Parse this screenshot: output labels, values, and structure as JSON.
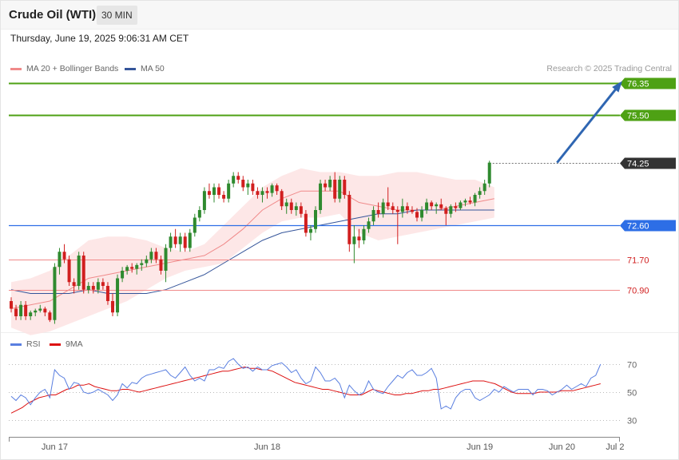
{
  "header": {
    "title": "Crude Oil (WTI)",
    "interval": "30 MIN"
  },
  "timestamp": "Thursday, June 19, 2025 9:06:31 AM CET",
  "legend": {
    "ma20_label": "MA 20 + Bollinger Bands",
    "ma50_label": "MA 50",
    "credit": "Research © 2025 Trading Central"
  },
  "rsi_legend": {
    "rsi_label": "RSI",
    "ma_label": "9MA"
  },
  "colors": {
    "resistance": "#4ea114",
    "support_blue": "#2d6ee6",
    "support_red": "#f08a8a",
    "current": "#333333",
    "up": "#2f8a2f",
    "down": "#d11f1f",
    "bollinger_fill": "#fde3e3",
    "ma20": "#f08a8a",
    "ma50": "#35559a",
    "arrow": "#2f66b2",
    "rsi": "#5a7fe0",
    "rsi_ma": "#dd1111"
  },
  "chart_data": {
    "type": "candlestick",
    "price_axis": {
      "min": 69.8,
      "max": 76.6
    },
    "levels": [
      {
        "value": 76.35,
        "label": "76.35",
        "kind": "resistance"
      },
      {
        "value": 75.5,
        "label": "75.50",
        "kind": "resistance"
      },
      {
        "value": 74.25,
        "label": "74.25",
        "kind": "current"
      },
      {
        "value": 72.6,
        "label": "72.60",
        "kind": "pivot"
      },
      {
        "value": 71.7,
        "label": "71.70",
        "kind": "support"
      },
      {
        "value": 70.9,
        "label": "70.90",
        "kind": "support"
      }
    ],
    "x_ticks": [
      "Jun 17",
      "Jun 18",
      "Jun 19",
      "Jun 20",
      "Jul 2"
    ],
    "x_tick_index": [
      9,
      53,
      97,
      114,
      125
    ],
    "x_count": 127,
    "projection": {
      "from_index": 113,
      "from_value": 74.25,
      "to_index": 127,
      "to_value": 76.35
    },
    "candles": [
      [
        70.6,
        70.7,
        70.3,
        70.4
      ],
      [
        70.4,
        70.5,
        70.1,
        70.2
      ],
      [
        70.2,
        70.6,
        70.1,
        70.5
      ],
      [
        70.5,
        70.6,
        70.1,
        70.2
      ],
      [
        70.2,
        70.35,
        70.1,
        70.3
      ],
      [
        70.3,
        70.4,
        70.2,
        70.35
      ],
      [
        70.35,
        70.5,
        70.3,
        70.4
      ],
      [
        70.4,
        70.45,
        70.2,
        70.3
      ],
      [
        70.3,
        70.35,
        70.05,
        70.1
      ],
      [
        70.1,
        71.6,
        70.0,
        71.5
      ],
      [
        71.5,
        72.0,
        71.3,
        71.9
      ],
      [
        71.9,
        72.1,
        71.6,
        71.7
      ],
      [
        71.7,
        71.8,
        71.0,
        71.1
      ],
      [
        71.1,
        71.2,
        70.8,
        71.0
      ],
      [
        71.0,
        71.9,
        70.9,
        71.8
      ],
      [
        71.8,
        71.9,
        70.8,
        70.9
      ],
      [
        70.9,
        71.1,
        70.8,
        71.0
      ],
      [
        71.0,
        71.1,
        70.8,
        70.9
      ],
      [
        70.9,
        71.2,
        70.8,
        71.1
      ],
      [
        71.1,
        71.2,
        70.9,
        71.0
      ],
      [
        71.0,
        71.1,
        70.5,
        70.6
      ],
      [
        70.6,
        70.8,
        70.2,
        70.3
      ],
      [
        70.3,
        71.3,
        70.2,
        71.2
      ],
      [
        71.2,
        71.5,
        71.1,
        71.4
      ],
      [
        71.4,
        71.55,
        71.3,
        71.5
      ],
      [
        71.5,
        71.6,
        71.35,
        71.45
      ],
      [
        71.45,
        71.6,
        71.3,
        71.55
      ],
      [
        71.55,
        71.7,
        71.4,
        71.6
      ],
      [
        71.6,
        71.8,
        71.5,
        71.7
      ],
      [
        71.7,
        72.0,
        71.6,
        71.9
      ],
      [
        71.9,
        72.0,
        71.6,
        71.7
      ],
      [
        71.7,
        71.8,
        71.3,
        71.4
      ],
      [
        71.4,
        72.1,
        71.1,
        72.0
      ],
      [
        72.0,
        72.4,
        71.9,
        72.3
      ],
      [
        72.3,
        72.5,
        72.0,
        72.1
      ],
      [
        72.1,
        72.4,
        71.9,
        72.3
      ],
      [
        72.3,
        72.4,
        71.9,
        72.0
      ],
      [
        72.0,
        72.5,
        71.9,
        72.4
      ],
      [
        72.4,
        72.9,
        72.3,
        72.8
      ],
      [
        72.8,
        73.1,
        72.7,
        73.0
      ],
      [
        73.0,
        73.6,
        72.9,
        73.5
      ],
      [
        73.5,
        73.7,
        73.3,
        73.4
      ],
      [
        73.4,
        73.7,
        73.2,
        73.6
      ],
      [
        73.6,
        73.7,
        73.3,
        73.4
      ],
      [
        73.4,
        73.5,
        73.2,
        73.3
      ],
      [
        73.3,
        73.8,
        73.2,
        73.7
      ],
      [
        73.7,
        74.0,
        73.6,
        73.9
      ],
      [
        73.9,
        74.0,
        73.7,
        73.8
      ],
      [
        73.8,
        73.9,
        73.5,
        73.6
      ],
      [
        73.6,
        73.8,
        73.4,
        73.7
      ],
      [
        73.7,
        73.8,
        73.4,
        73.5
      ],
      [
        73.5,
        73.6,
        73.3,
        73.4
      ],
      [
        73.4,
        73.6,
        73.2,
        73.5
      ],
      [
        73.5,
        73.6,
        73.3,
        73.45
      ],
      [
        73.45,
        73.7,
        73.35,
        73.65
      ],
      [
        73.65,
        73.7,
        73.4,
        73.5
      ],
      [
        73.5,
        73.55,
        73.0,
        73.1
      ],
      [
        73.1,
        73.3,
        72.9,
        73.2
      ],
      [
        73.2,
        73.3,
        72.9,
        73.0
      ],
      [
        73.0,
        73.2,
        72.85,
        73.1
      ],
      [
        73.1,
        73.2,
        72.8,
        72.9
      ],
      [
        72.9,
        73.0,
        72.3,
        72.4
      ],
      [
        72.4,
        72.6,
        72.2,
        72.5
      ],
      [
        72.5,
        73.1,
        72.4,
        73.0
      ],
      [
        73.0,
        73.8,
        72.9,
        73.7
      ],
      [
        73.7,
        73.8,
        73.5,
        73.6
      ],
      [
        73.6,
        73.9,
        73.5,
        73.8
      ],
      [
        73.8,
        74.0,
        73.2,
        73.3
      ],
      [
        73.3,
        73.9,
        73.2,
        73.8
      ],
      [
        73.8,
        73.9,
        73.3,
        73.4
      ],
      [
        73.4,
        73.5,
        71.9,
        72.1
      ],
      [
        72.1,
        72.6,
        71.6,
        72.3
      ],
      [
        72.3,
        72.5,
        72.0,
        72.2
      ],
      [
        72.2,
        72.6,
        72.1,
        72.5
      ],
      [
        72.5,
        72.8,
        72.4,
        72.7
      ],
      [
        72.7,
        73.1,
        72.6,
        73.0
      ],
      [
        73.0,
        73.2,
        72.8,
        72.9
      ],
      [
        72.9,
        73.3,
        72.8,
        73.2
      ],
      [
        73.2,
        73.6,
        73.0,
        73.1
      ],
      [
        73.1,
        73.2,
        72.9,
        73.0
      ],
      [
        73.0,
        73.1,
        72.1,
        72.95
      ],
      [
        72.95,
        73.3,
        72.8,
        73.1
      ],
      [
        73.1,
        73.2,
        72.9,
        73.0
      ],
      [
        73.0,
        73.1,
        72.9,
        72.95
      ],
      [
        72.95,
        73.05,
        72.7,
        72.8
      ],
      [
        72.8,
        73.1,
        72.7,
        73.0
      ],
      [
        73.0,
        73.3,
        72.9,
        73.2
      ],
      [
        73.2,
        73.25,
        73.0,
        73.1
      ],
      [
        73.1,
        73.2,
        72.9,
        73.15
      ],
      [
        73.15,
        73.3,
        73.0,
        73.05
      ],
      [
        73.05,
        73.1,
        72.6,
        72.9
      ],
      [
        72.9,
        73.15,
        72.8,
        73.1
      ],
      [
        73.1,
        73.2,
        72.95,
        73.05
      ],
      [
        73.05,
        73.25,
        73.0,
        73.2
      ],
      [
        73.2,
        73.3,
        73.1,
        73.25
      ],
      [
        73.25,
        73.35,
        73.15,
        73.2
      ],
      [
        73.2,
        73.45,
        73.1,
        73.4
      ],
      [
        73.4,
        73.6,
        73.3,
        73.5
      ],
      [
        73.5,
        73.8,
        73.4,
        73.7
      ],
      [
        73.7,
        74.3,
        73.6,
        74.25
      ]
    ],
    "bollinger": {
      "upper": [
        71.1,
        71.2,
        71.4,
        71.8,
        72.2,
        72.3,
        72.3,
        72.2,
        72.0,
        71.9,
        72.1,
        72.6,
        73.1,
        73.6,
        73.9,
        74.1,
        74.0,
        74.0,
        73.9,
        73.9,
        74.0,
        74.0,
        73.9,
        73.8,
        73.8,
        73.6
      ],
      "lower": [
        69.9,
        69.7,
        69.8,
        70.0,
        70.2,
        70.4,
        70.6,
        70.9,
        71.2,
        71.4,
        71.5,
        71.6,
        72.0,
        72.4,
        72.7,
        72.8,
        72.8,
        72.9,
        72.4,
        72.2,
        72.3,
        72.4,
        72.5,
        72.6,
        72.7,
        72.8
      ],
      "ma20": [
        70.4,
        70.5,
        70.6,
        70.9,
        71.2,
        71.3,
        71.4,
        71.5,
        71.6,
        71.7,
        71.8,
        72.1,
        72.5,
        73.0,
        73.3,
        73.5,
        73.5,
        73.5,
        73.2,
        73.1,
        73.0,
        73.0,
        73.0,
        73.1,
        73.2,
        73.3
      ]
    },
    "ma50": [
      70.9,
      70.8,
      70.8,
      70.8,
      70.9,
      70.8,
      70.8,
      70.8,
      70.9,
      71.1,
      71.3,
      71.6,
      71.9,
      72.2,
      72.4,
      72.5,
      72.6,
      72.7,
      72.8,
      72.9,
      72.9,
      73.0,
      73.0,
      73.0,
      73.0,
      73.0
    ],
    "rsi_axis": {
      "min": 22,
      "max": 78,
      "levels": [
        70,
        50,
        30
      ]
    },
    "rsi": [
      47,
      44,
      48,
      46,
      41,
      46,
      50,
      52,
      46,
      66,
      62,
      60,
      52,
      57,
      56,
      50,
      49,
      50,
      52,
      50,
      48,
      44,
      48,
      56,
      53,
      57,
      56,
      60,
      62,
      63,
      64,
      65,
      66,
      62,
      60,
      64,
      68,
      62,
      58,
      60,
      58,
      66,
      66,
      68,
      67,
      72,
      74,
      70,
      67,
      68,
      65,
      68,
      66,
      66,
      69,
      70,
      71,
      68,
      64,
      66,
      60,
      56,
      58,
      68,
      64,
      58,
      58,
      60,
      56,
      46,
      55,
      51,
      48,
      50,
      58,
      52,
      50,
      49,
      54,
      58,
      62,
      60,
      64,
      66,
      62,
      62,
      64,
      67,
      60,
      38,
      40,
      38,
      46,
      50,
      52,
      52,
      46,
      44,
      46,
      48,
      52,
      50,
      54,
      52,
      50,
      52,
      52,
      52,
      48,
      52,
      52,
      51,
      48,
      50,
      52,
      55,
      52,
      54,
      56,
      54,
      60,
      62,
      70
    ],
    "rsi_ma": [
      35,
      37,
      39,
      42,
      44,
      46,
      47,
      48,
      48,
      50,
      52,
      53,
      55,
      55,
      56,
      54,
      53,
      52,
      51,
      51,
      52,
      52,
      51,
      50,
      51,
      52,
      53,
      54,
      55,
      56,
      57,
      58,
      59,
      60,
      61,
      62,
      63,
      64,
      65,
      65,
      66,
      67,
      68,
      67,
      67,
      66,
      66,
      65,
      63,
      61,
      59,
      57,
      56,
      55,
      54,
      53,
      52,
      52,
      51,
      50,
      49,
      48,
      48,
      48,
      50,
      52,
      51,
      50,
      49,
      48,
      48,
      49,
      49,
      50,
      51,
      51,
      52,
      52,
      53,
      54,
      55,
      56,
      57,
      58,
      58,
      58,
      57,
      56,
      54,
      52,
      50,
      49,
      49,
      49,
      49,
      50,
      50,
      50,
      50,
      51,
      51,
      51,
      52,
      53,
      54,
      55,
      56
    ]
  }
}
